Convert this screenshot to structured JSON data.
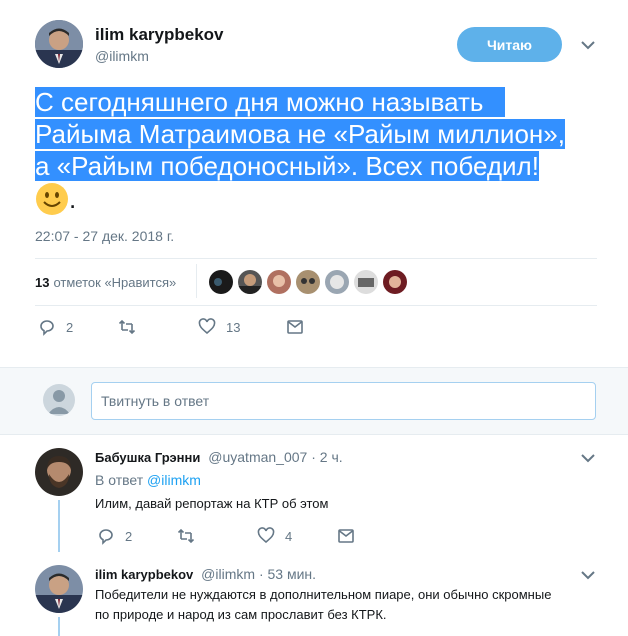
{
  "main_tweet": {
    "author_name": "ilim karypbekov",
    "author_handle": "@ilimkm",
    "follow_label": "Читаю",
    "text_line1": "С сегодняшнего дня можно называть",
    "text_line2": "Райыма Матраимова не «Райым миллион»,",
    "text_line3": "а «Райым победоносный». Всех победил!",
    "text_end": ".",
    "timestamp": "22:07 - 27 дек. 2018 г.",
    "likes_count": "13",
    "likes_label": "отметок «Нравится»",
    "replies_count": "2",
    "likes_action_count": "13"
  },
  "reply_box": {
    "placeholder": "Твитнуть в ответ"
  },
  "replies": [
    {
      "author_name": "Бабушка Грэнни",
      "author_handle": "@uyatman_007",
      "time": "· 2 ч.",
      "in_reply_prefix": "В ответ",
      "in_reply_handle": "@ilimkm",
      "text": "Илим, давай репортаж на КТР об этом",
      "replies_count": "2",
      "likes_count": "4"
    },
    {
      "author_name": "ilim karypbekov",
      "author_handle": "@ilimkm",
      "time": "· 53 мин.",
      "text_line1": "Победители не нуждаются в дополнительном пиаре, они обычно скромные",
      "text_line2": "по природе и народ из сам прославит без КТРК."
    }
  ],
  "colors": {
    "accent": "#1da1f2",
    "follow_button": "#5eb1ea",
    "selection": "#3390ff",
    "muted_text": "#657786",
    "thread_line": "#a5d0f0"
  },
  "icons": [
    "reply-icon",
    "retweet-icon",
    "like-icon",
    "direct-message-icon",
    "chevron-down-icon",
    "smile-emoji-icon"
  ]
}
